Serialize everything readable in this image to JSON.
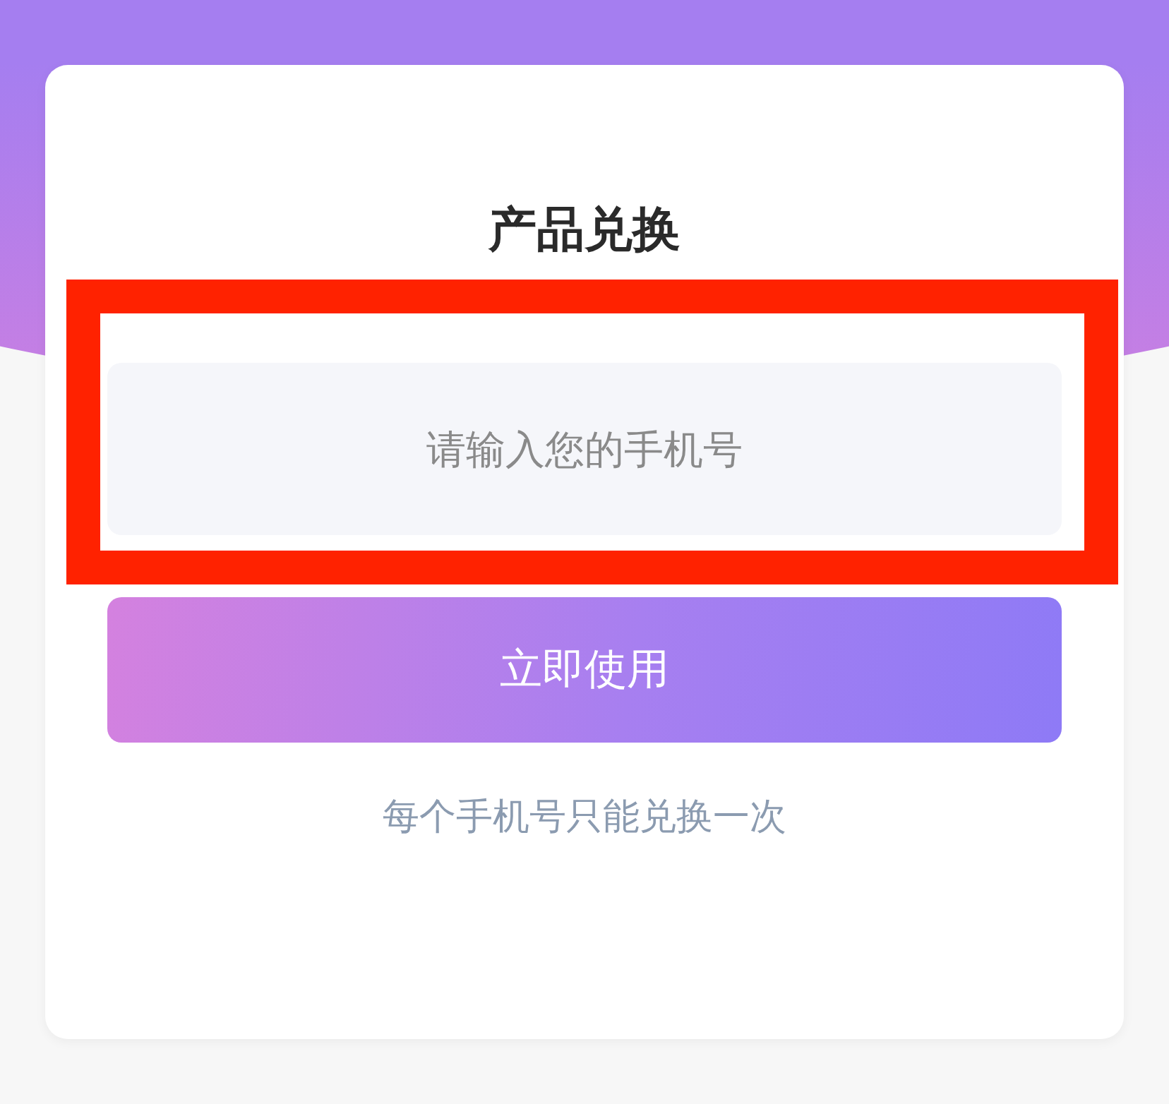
{
  "title": "产品兑换",
  "phone_field": {
    "placeholder": "请输入您的手机号"
  },
  "submit_button": {
    "label": "立即使用"
  },
  "note": "每个手机号只能兑换一次",
  "annotation": {
    "kind": "frame"
  }
}
